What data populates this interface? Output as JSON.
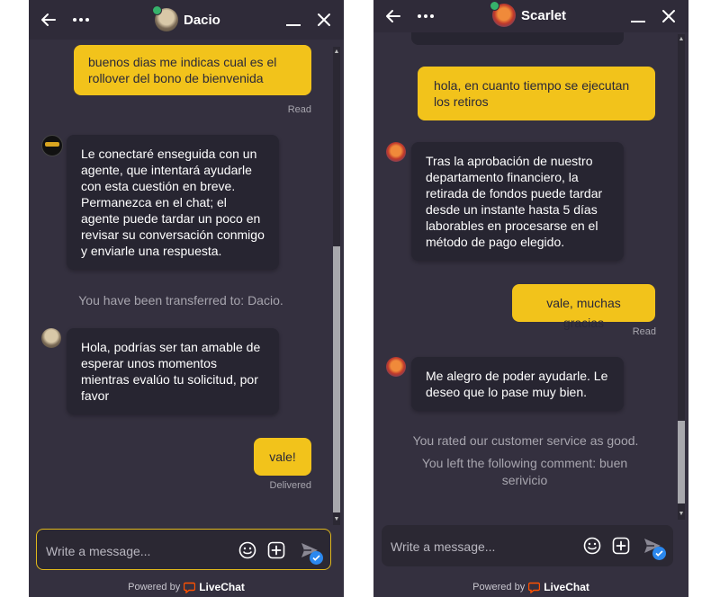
{
  "colors": {
    "panel_bg": "#34303f",
    "header_bg": "#2f2b39",
    "visitor_bubble": "#f2c31b",
    "agent_bubble": "#272531",
    "accent_blue": "#2b88ee",
    "livechat_orange": "#ff5100"
  },
  "left": {
    "header": {
      "agent_name": "Dacio",
      "back_icon": "arrow-left-icon",
      "more_icon": "more-icon",
      "minimize_icon": "minimize-icon",
      "close_icon": "close-icon"
    },
    "messages": {
      "m1": {
        "text": "buenos dias me indicas cual es el rollover del bono de bienvenida",
        "status": "Read"
      },
      "m2": {
        "text": "Le conectaré enseguida con un agente, que intentará ayudarle con esta cuestión en breve. Permanezca en el chat; el agente puede tardar un poco en revisar su conversación conmigo y enviarle una respuesta."
      },
      "m3": {
        "text": "You have been transferred to: Dacio."
      },
      "m4": {
        "text": "Hola, podrías ser tan amable de esperar unos momentos mientras evalúo tu solicitud, por favor"
      },
      "m5": {
        "text": "vale!",
        "status": "Delivered"
      }
    },
    "composer": {
      "placeholder": "Write a message..."
    },
    "footer": {
      "powered_by": "Powered by",
      "brand": "LiveChat"
    }
  },
  "right": {
    "header": {
      "agent_name": "Scarlet"
    },
    "messages": {
      "m1": {
        "text": "hola, en cuanto tiempo se ejecutan los retiros"
      },
      "m2": {
        "text": "Tras la aprobación de nuestro departamento financiero, la retirada de fondos puede tardar desde un instante hasta 5 días laborables en procesarse en el método de pago elegido."
      },
      "m3": {
        "text": "vale, muchas gracias",
        "status": "Read"
      },
      "m4": {
        "text": "Me alegro de poder ayudarle. Le deseo que lo pase muy bien."
      },
      "m5": {
        "text": "You rated our customer service as good."
      },
      "m6": {
        "text": "You left the following comment: buen serivicio"
      }
    },
    "composer": {
      "placeholder": "Write a message..."
    },
    "footer": {
      "powered_by": "Powered by",
      "brand": "LiveChat"
    }
  }
}
